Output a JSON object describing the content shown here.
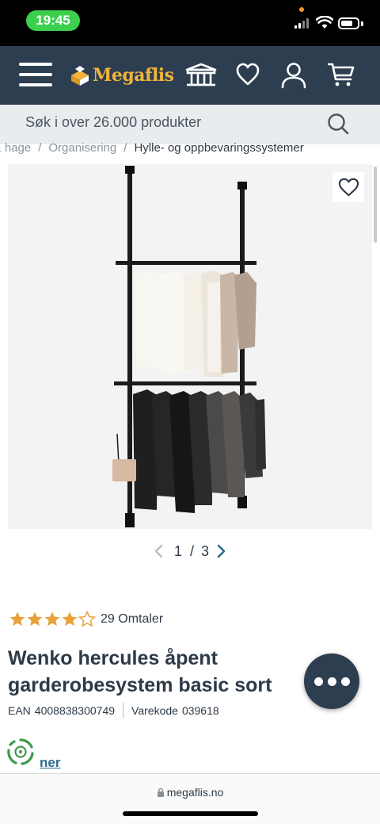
{
  "status_bar": {
    "time": "19:45"
  },
  "header": {
    "brand": "Megaflis"
  },
  "search": {
    "placeholder": "Søk i over 26.000 produkter"
  },
  "breadcrumb": [
    "s & hage",
    "Organisering",
    "Hylle- og oppbevaringssystemer"
  ],
  "gallery": {
    "current": "1",
    "total": "3",
    "separator": "/"
  },
  "rating": {
    "stars": 4,
    "max": 5,
    "reviews_label": "29 Omtaler"
  },
  "product": {
    "title": "Wenko hercules åpent garderobesystem basic sort",
    "ean_label": "EAN",
    "ean": "4008838300749",
    "sku_label": "Varekode",
    "sku": "039618"
  },
  "eco": {
    "link_label": "ner"
  },
  "browser": {
    "url": "megaflis.no"
  },
  "colors": {
    "header_bg": "#2c3e50",
    "brand": "#f0b43c",
    "star": "#e8a23c",
    "pager_next": "#2c6c8c"
  }
}
